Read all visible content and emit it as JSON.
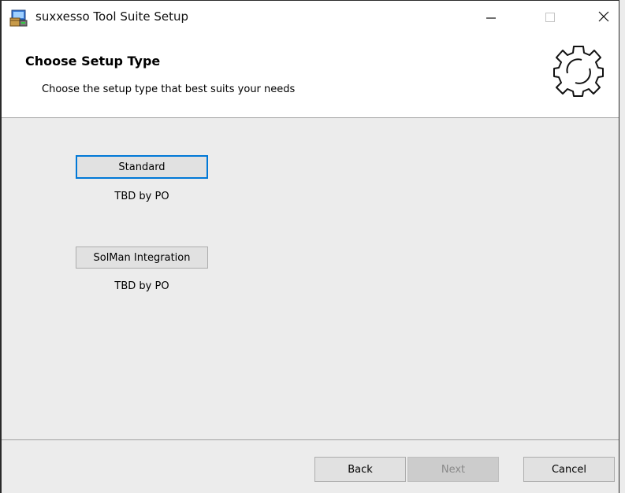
{
  "window": {
    "title": "suxxesso Tool Suite Setup",
    "controls": {
      "minimize": "minimize-icon",
      "maximize": "maximize-icon",
      "close": "close-icon"
    }
  },
  "header": {
    "title": "Choose Setup Type",
    "subtitle": "Choose the setup type that best suits your needs",
    "icon": "gear-icon"
  },
  "options": [
    {
      "label": "Standard",
      "description": "TBD by PO",
      "focused": true
    },
    {
      "label": "SolMan Integration",
      "description": "TBD by PO",
      "focused": false
    }
  ],
  "footer": {
    "back_label": "Back",
    "next_label": "Next",
    "next_enabled": false,
    "cancel_label": "Cancel"
  },
  "colors": {
    "focus_border": "#0078d7",
    "background": "#ececec",
    "header_background": "#ffffff"
  }
}
